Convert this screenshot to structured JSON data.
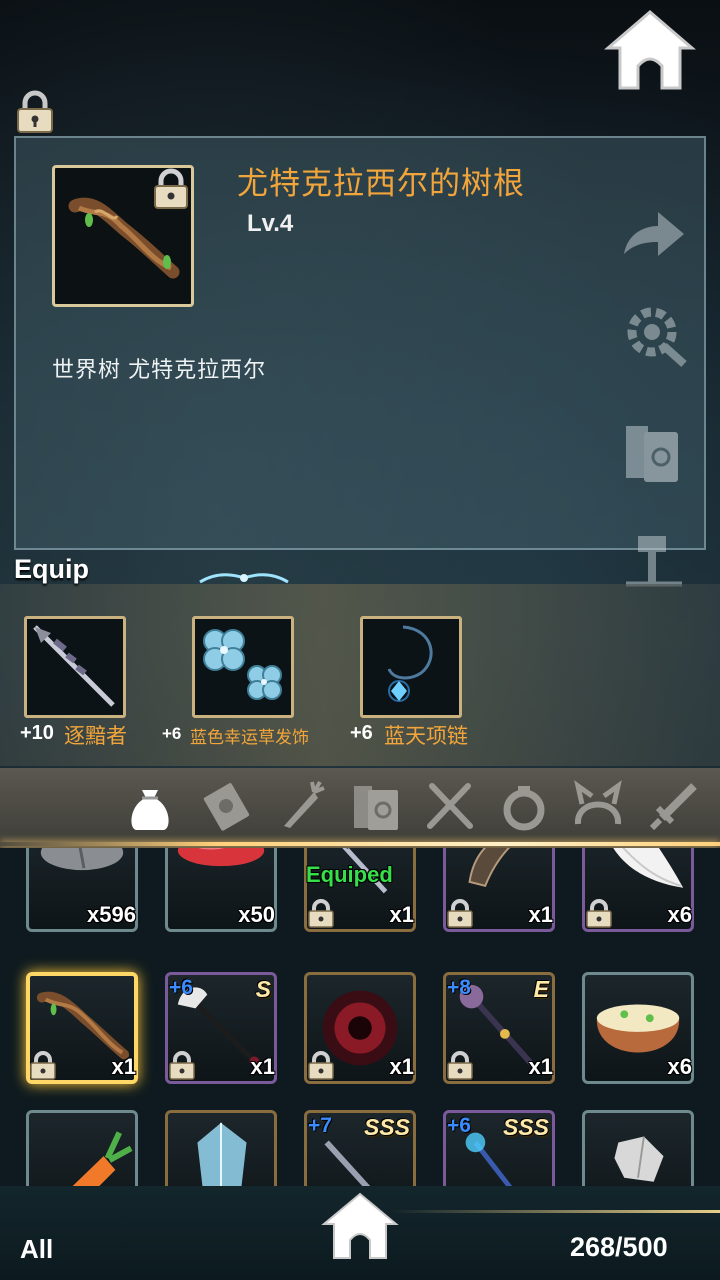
{
  "item": {
    "name": "尤特克拉西尔的树根",
    "level": "Lv.4",
    "description": "世界树 尤特克拉西尔"
  },
  "equip": {
    "title": "Equip",
    "slots": [
      {
        "level": "+10",
        "name": "逐黯者",
        "icon": "spear-icon"
      },
      {
        "level": "+6",
        "name": "蓝色幸运草发饰",
        "icon": "clover-hairpin-icon"
      },
      {
        "level": "+6",
        "name": "蓝天项链",
        "icon": "necklace-icon"
      }
    ]
  },
  "categories": [
    "bag-icon",
    "ticket-icon",
    "carrot-icon",
    "book-icon",
    "fork-knife-icon",
    "ring-icon",
    "headband-icon",
    "sword-icon"
  ],
  "inventory": [
    {
      "qty": "x596",
      "icon": "stone-icon",
      "frame": "teal",
      "locked": false
    },
    {
      "qty": "x50",
      "icon": "red-ore-icon",
      "frame": "teal",
      "locked": false
    },
    {
      "qty": "x1",
      "icon": "spear-icon",
      "frame": "orange",
      "locked": true,
      "status": "Equiped"
    },
    {
      "qty": "x1",
      "icon": "claw-icon",
      "frame": "purple",
      "locked": true
    },
    {
      "qty": "x6",
      "icon": "feather-icon",
      "frame": "purple",
      "locked": true
    },
    {
      "qty": "x1",
      "icon": "root-icon",
      "frame": "selected",
      "locked": true
    },
    {
      "qty": "x1",
      "icon": "axe-icon",
      "frame": "purple",
      "locked": true,
      "plus": "+6",
      "rank": "S"
    },
    {
      "qty": "x1",
      "icon": "dark-orb-icon",
      "frame": "orange",
      "locked": true
    },
    {
      "qty": "x1",
      "icon": "mace-icon",
      "frame": "orange",
      "locked": true,
      "plus": "+8",
      "rank": "E"
    },
    {
      "qty": "x6",
      "icon": "rice-bowl-icon",
      "frame": "teal",
      "locked": false
    },
    {
      "qty": "",
      "icon": "carrot-icon",
      "frame": "teal",
      "locked": false
    },
    {
      "qty": "",
      "icon": "crystal-icon",
      "frame": "orange",
      "locked": false
    },
    {
      "qty": "",
      "icon": "sword-icon",
      "frame": "orange",
      "locked": false,
      "plus": "+7",
      "rank": "SSS"
    },
    {
      "qty": "",
      "icon": "staff-icon",
      "frame": "purple",
      "locked": false,
      "plus": "+6",
      "rank": "SSS"
    },
    {
      "qty": "",
      "icon": "gem-icon",
      "frame": "teal",
      "locked": false
    }
  ],
  "footer": {
    "filter": "All",
    "capacity": "268/500"
  },
  "colors": {
    "item_name": "#f2a53a",
    "equipped": "#35e04a",
    "plus": "#3a8cff",
    "selected": "#ffd766"
  }
}
